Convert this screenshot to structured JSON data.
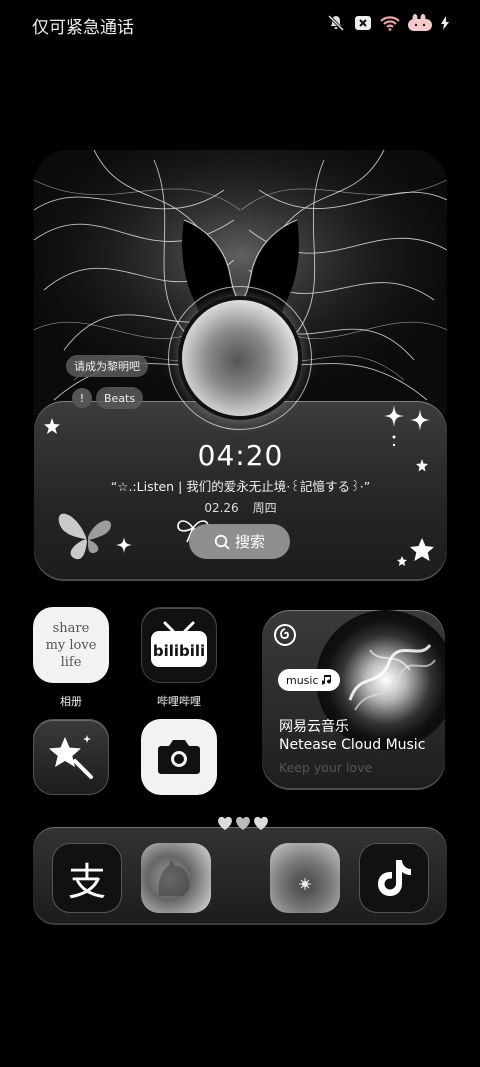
{
  "status_bar": {
    "carrier_text": "仅可紧急通话",
    "icons": [
      "mute-icon",
      "no-sim-icon",
      "wifi-icon",
      "bunny-battery-icon",
      "charging-icon"
    ]
  },
  "music_widget": {
    "lyric_tag": "请成为黎明吧",
    "alert_glyph": "!",
    "beats_tag": "Beats",
    "time": "04:20",
    "song_line": "“☆.:Listen | 我们的爱永无止境·꒰記憶する꒱·”",
    "date": "02.26",
    "weekday": "周四",
    "search_label": "搜索"
  },
  "apps": {
    "album": {
      "label": "相册",
      "art_lines": [
        "share",
        "my love",
        "life"
      ]
    },
    "bilibili": {
      "label": "哔哩哔哩",
      "logo_text": "bilibili"
    },
    "magic": {
      "label": ""
    },
    "camera": {
      "label": ""
    }
  },
  "netease": {
    "bubble": "music",
    "title": "网易云音乐",
    "subtitle": "Netease Cloud Music",
    "tagline": "Keep your love"
  },
  "dock": {
    "hearts": "🤍🤍🤍",
    "alipay_glyph": "支"
  }
}
